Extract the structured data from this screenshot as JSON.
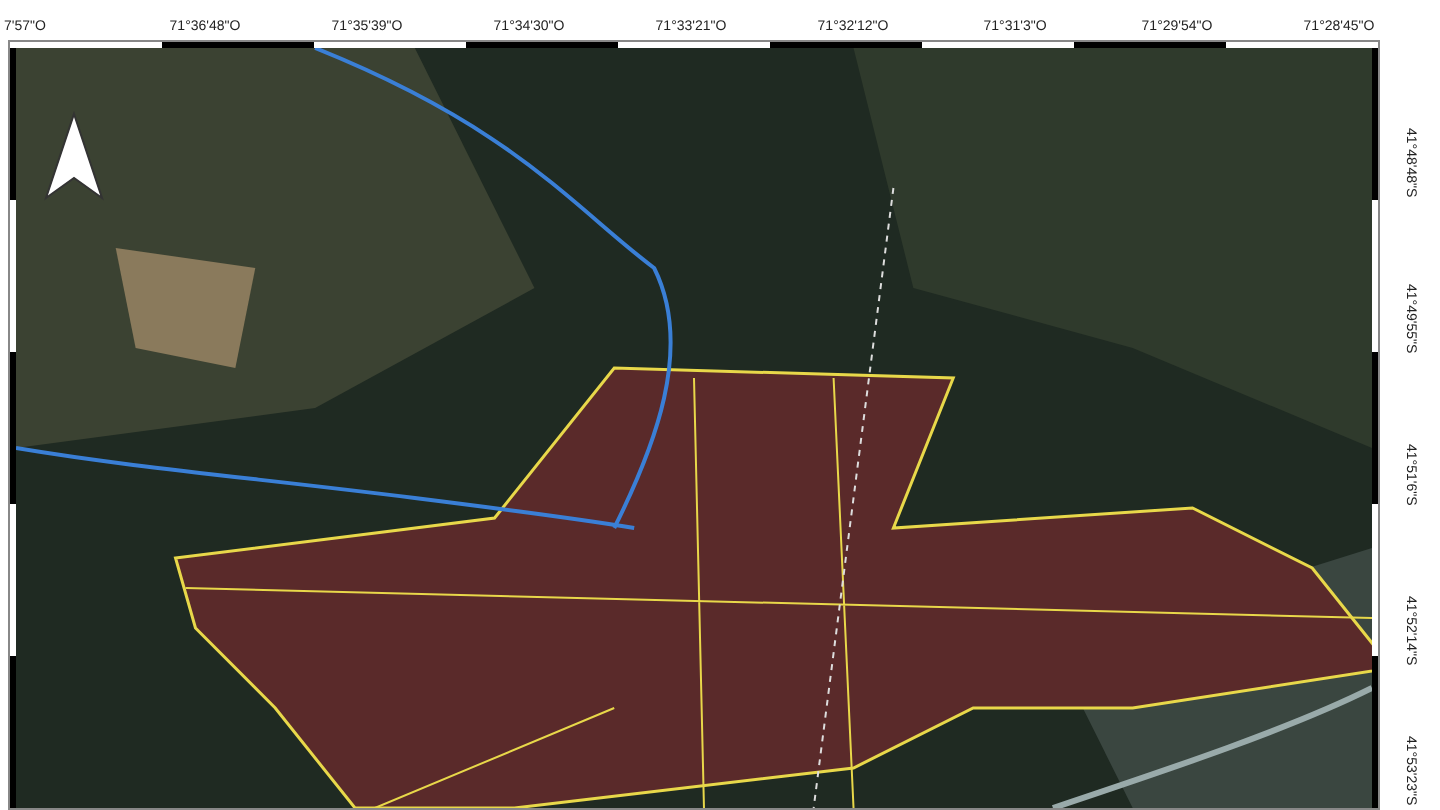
{
  "top_ticks": [
    "7'57\"O",
    "71°36'48\"O",
    "71°35'39\"O",
    "71°34'30\"O",
    "71°33'21\"O",
    "71°32'12\"O",
    "71°31'3\"O",
    "71°29'54\"O",
    "71°28'45\"O"
  ],
  "right_ticks": [
    "41°48'48\"S",
    "41°49'55\"S",
    "41°51'6\"S",
    "41°52'14\"S",
    "41°53'23\"S"
  ]
}
